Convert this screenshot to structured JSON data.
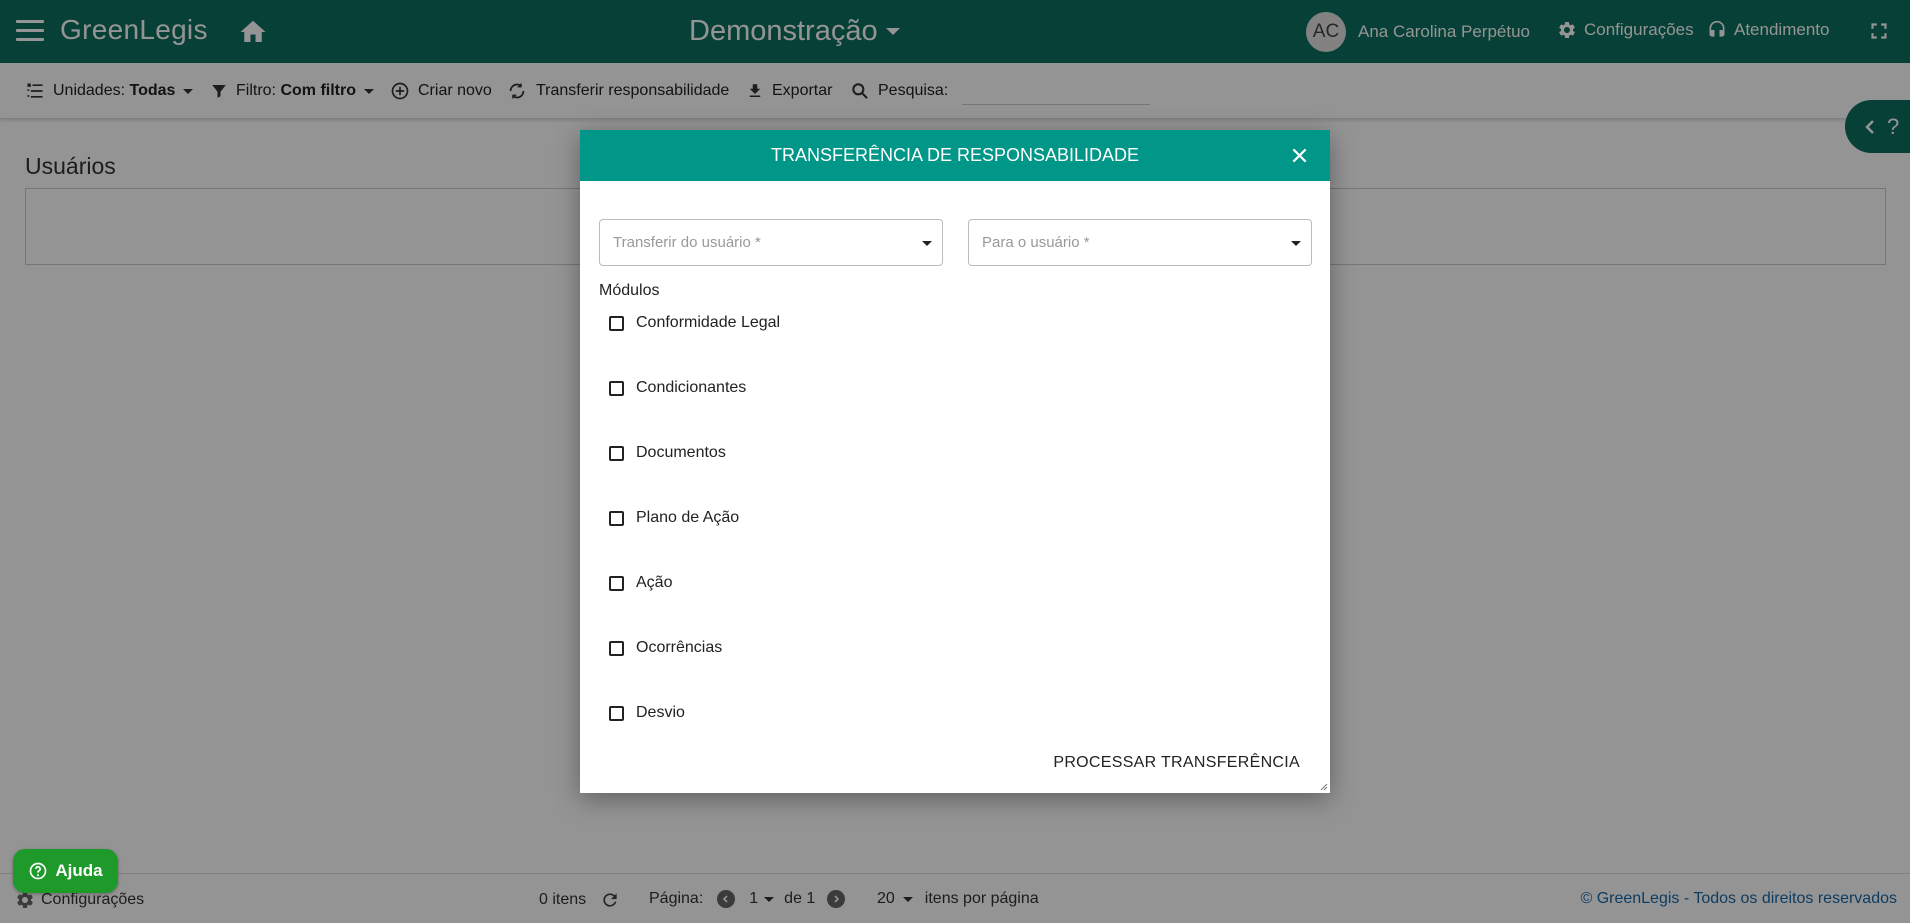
{
  "app": {
    "brand": "GreenLegis",
    "workspace": "Demonstração",
    "user_initials": "AC",
    "user_name": "Ana Carolina Perpétuo",
    "settings_label": "Configurações",
    "support_label": "Atendimento"
  },
  "toolbar": {
    "units_label": "Unidades:",
    "units_value": "Todas",
    "filter_label": "Filtro:",
    "filter_value": "Com filtro",
    "create_label": "Criar novo",
    "transfer_label": "Transferir responsabilidade",
    "export_label": "Exportar",
    "search_label": "Pesquisa:",
    "search_value": ""
  },
  "help_tab": {
    "label": "?"
  },
  "page": {
    "title": "Usuários"
  },
  "footer": {
    "settings_label": "Configurações",
    "items_count": "0 itens",
    "page_label": "Página:",
    "page_current": "1",
    "page_of": "de 1",
    "page_size": "20",
    "per_page_label": "itens por página",
    "copyright": "© GreenLegis - Todos os direitos reservados",
    "help_button": "Ajuda"
  },
  "modal": {
    "title": "TRANSFERÊNCIA DE RESPONSABILIDADE",
    "from_placeholder": "Transferir do usuário *",
    "to_placeholder": "Para o usuário *",
    "modules_label": "Módulos",
    "modules": [
      {
        "label": "Conformidade Legal",
        "checked": false
      },
      {
        "label": "Condicionantes",
        "checked": false
      },
      {
        "label": "Documentos",
        "checked": false
      },
      {
        "label": "Plano de Ação",
        "checked": false
      },
      {
        "label": "Ação",
        "checked": false
      },
      {
        "label": "Ocorrências",
        "checked": false
      },
      {
        "label": "Desvio",
        "checked": false
      }
    ],
    "process_label": "PROCESSAR TRANSFERÊNCIA"
  },
  "colors": {
    "primary": "#0b6e5d",
    "modal_header": "#009688",
    "help_button": "#1e9a2a",
    "link": "#1769aa"
  },
  "icons": [
    "menu-icon",
    "home-icon",
    "gear-icon",
    "headset-icon",
    "fullscreen-icon",
    "tree-icon",
    "filter-icon",
    "add-circle-icon",
    "transfer-icon",
    "download-icon",
    "search-icon",
    "chevron-left-icon",
    "help-icon",
    "refresh-icon",
    "close-icon"
  ]
}
